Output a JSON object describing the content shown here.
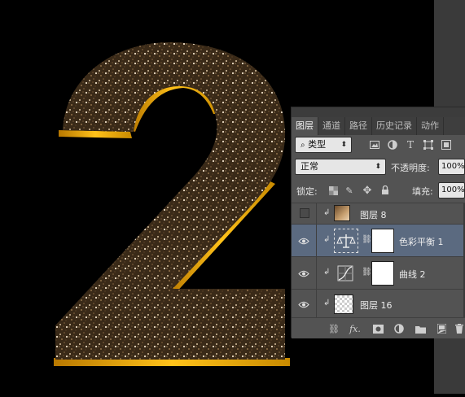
{
  "panel": {
    "tabs": [
      "图层",
      "通道",
      "路径",
      "历史记录",
      "动作"
    ],
    "filter_label": "类型",
    "filter_icons": [
      "image-filter-icon",
      "adjustment-filter-icon",
      "type-filter-icon",
      "shape-filter-icon",
      "smart-object-filter-icon"
    ],
    "blend_mode": "正常",
    "opacity_label": "不透明度:",
    "opacity_value": "100%",
    "lock_label": "锁定:",
    "fill_label": "填充:",
    "fill_value": "100%",
    "layers": [
      {
        "name": "图层 8",
        "visible": false,
        "clipped": true,
        "type": "image"
      },
      {
        "name": "色彩平衡 1",
        "visible": true,
        "clipped": true,
        "type": "color-balance",
        "selected": true
      },
      {
        "name": "曲线 2",
        "visible": true,
        "clipped": true,
        "type": "curves"
      },
      {
        "name": "图层 16",
        "visible": true,
        "clipped": true,
        "type": "transparent"
      }
    ],
    "bottom_icons": [
      "link-icon",
      "fx-icon",
      "mask-icon",
      "adjustment-icon",
      "folder-icon",
      "new-layer-icon",
      "trash-icon"
    ],
    "fx_label": "fx."
  },
  "colors": {
    "panel_bg": "#535353",
    "selected_row": "#5b6a80",
    "gold": "#f0a800",
    "canvas_bg": "#000000"
  }
}
